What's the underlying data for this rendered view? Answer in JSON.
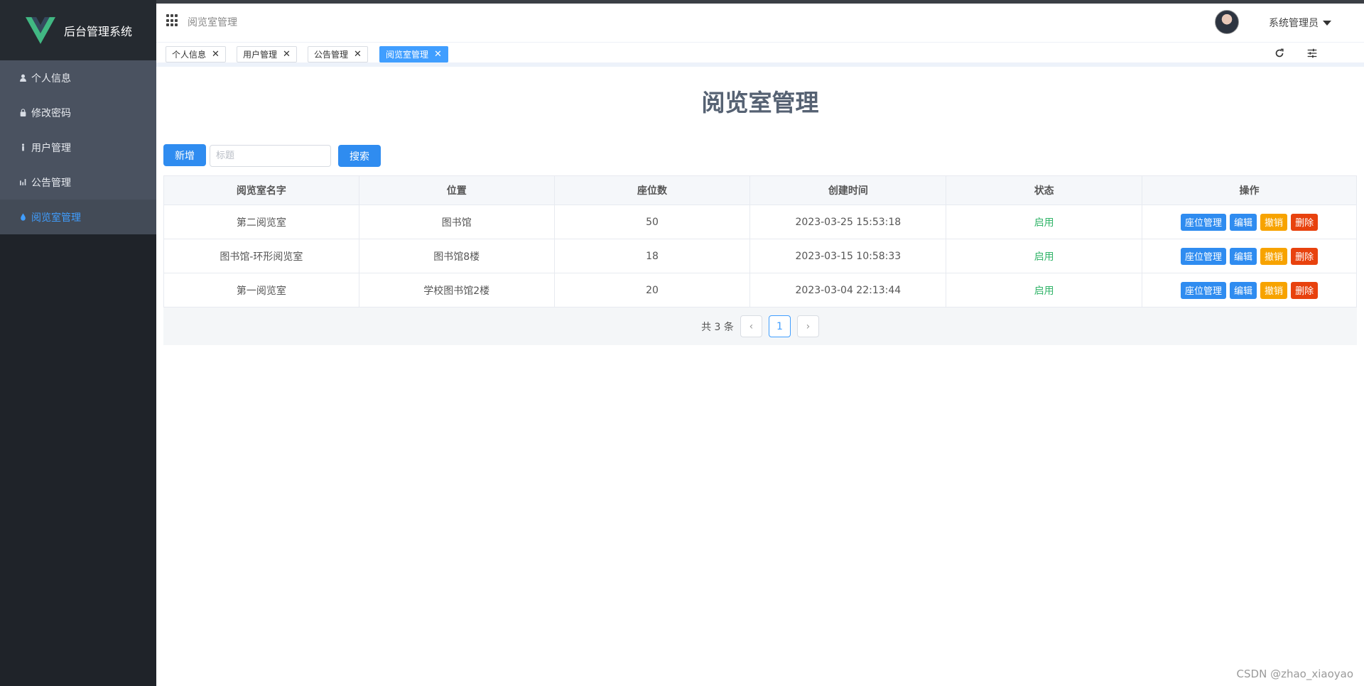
{
  "app": {
    "title": "后台管理系统",
    "accent": "#409eff"
  },
  "sidebar": {
    "items": [
      {
        "label": "个人信息",
        "icon": "user-icon"
      },
      {
        "label": "修改密码",
        "icon": "lock-icon"
      },
      {
        "label": "用户管理",
        "icon": "person-icon"
      },
      {
        "label": "公告管理",
        "icon": "bar-chart-icon"
      },
      {
        "label": "阅览室管理",
        "icon": "drop-icon",
        "active": true
      }
    ]
  },
  "header": {
    "breadcrumb": "阅览室管理",
    "user_name": "系统管理员"
  },
  "tabs": [
    {
      "label": "个人信息",
      "close": "✕"
    },
    {
      "label": "用户管理",
      "close": "✕"
    },
    {
      "label": "公告管理",
      "close": "✕"
    },
    {
      "label": "阅览室管理",
      "close": "✕",
      "active": true
    }
  ],
  "main": {
    "title": "阅览室管理",
    "add_label": "新增",
    "search_placeholder": "标题",
    "search_label": "搜索"
  },
  "table": {
    "headers": [
      "阅览室名字",
      "位置",
      "座位数",
      "创建时间",
      "状态",
      "操作"
    ],
    "rows": [
      {
        "name": "第二阅览室",
        "location": "图书馆",
        "seats": "50",
        "created": "2023-03-25 15:53:18",
        "status": "启用"
      },
      {
        "name": "图书馆-环形阅览室",
        "location": "图书馆8楼",
        "seats": "18",
        "created": "2023-03-15 10:58:33",
        "status": "启用"
      },
      {
        "name": "第一阅览室",
        "location": "学校图书馆2楼",
        "seats": "20",
        "created": "2023-03-04 22:13:44",
        "status": "启用"
      }
    ],
    "actions": {
      "seat": "座位管理",
      "edit": "编辑",
      "revoke": "撤销",
      "delete": "删除"
    }
  },
  "pagination": {
    "total_text": "共 3 条",
    "current": "1",
    "prev": "‹",
    "next": "›"
  },
  "watermark": "CSDN @zhao_xiaoyao"
}
